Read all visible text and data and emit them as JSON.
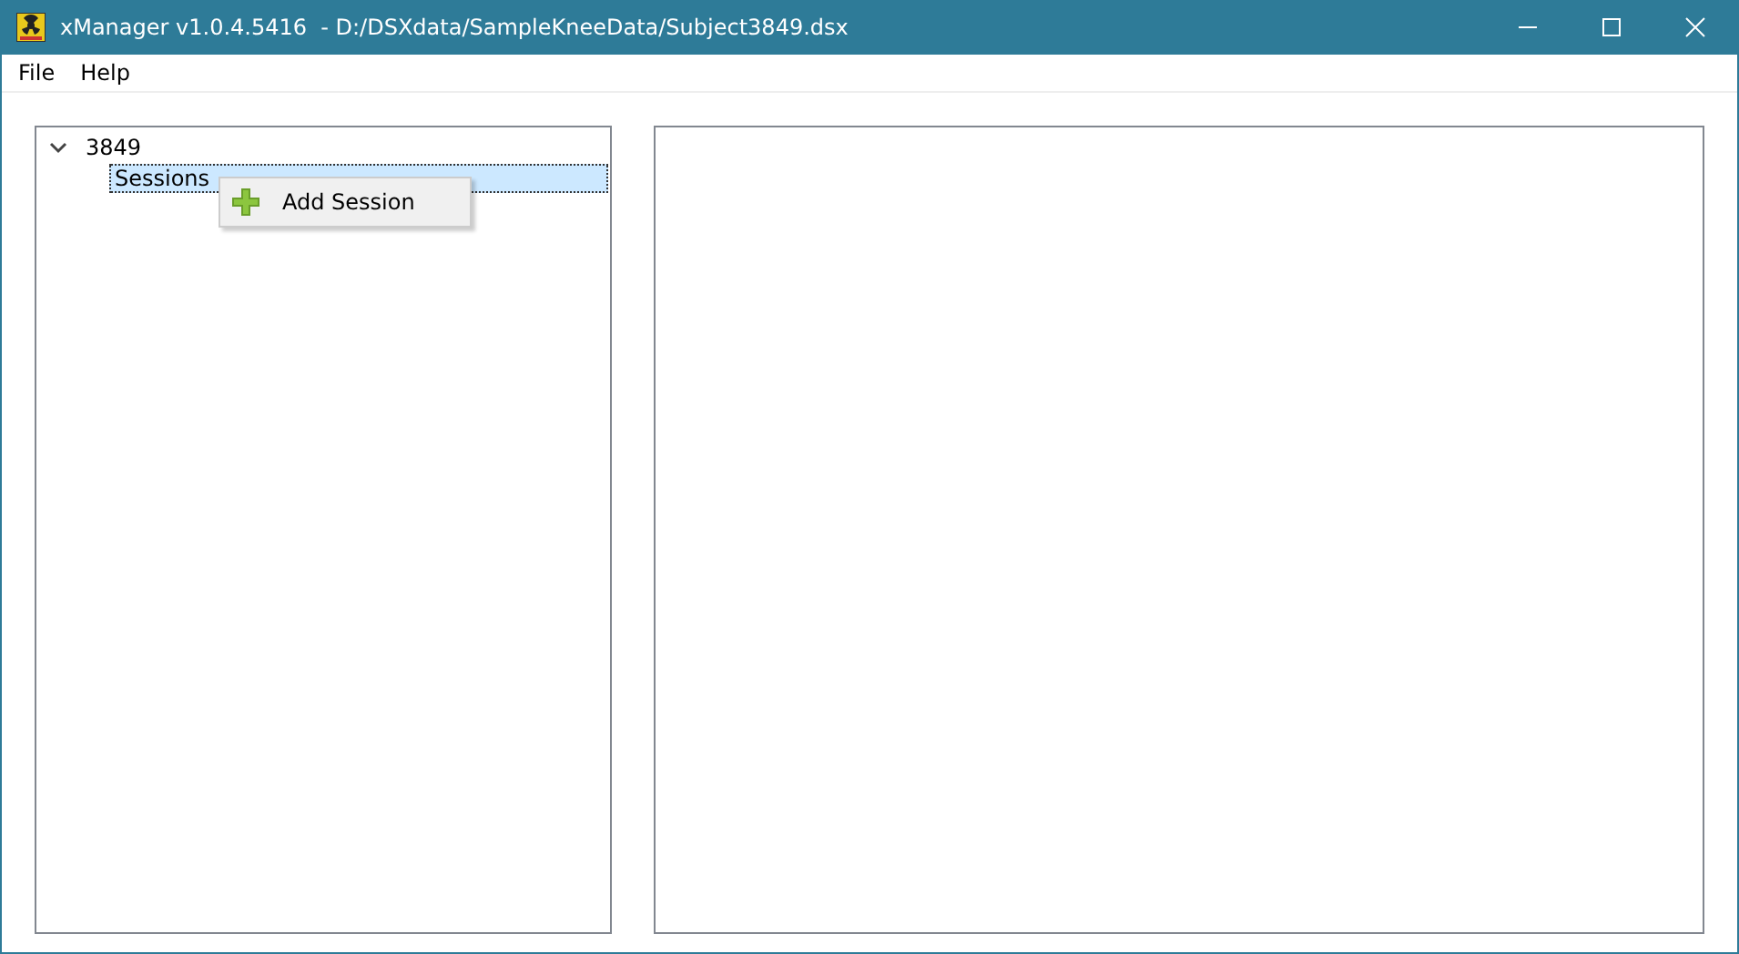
{
  "window": {
    "title": "xManager v1.0.4.5416  - D:/DSXdata/SampleKneeData/Subject3849.dsx"
  },
  "menu": [
    "File",
    "Help"
  ],
  "tree": [
    {
      "label": "3849",
      "expanded": true,
      "selected": false,
      "children": [
        {
          "label": "Sessions",
          "selected": true
        }
      ]
    }
  ],
  "context_menu": [
    {
      "label": "Add Session"
    }
  ]
}
